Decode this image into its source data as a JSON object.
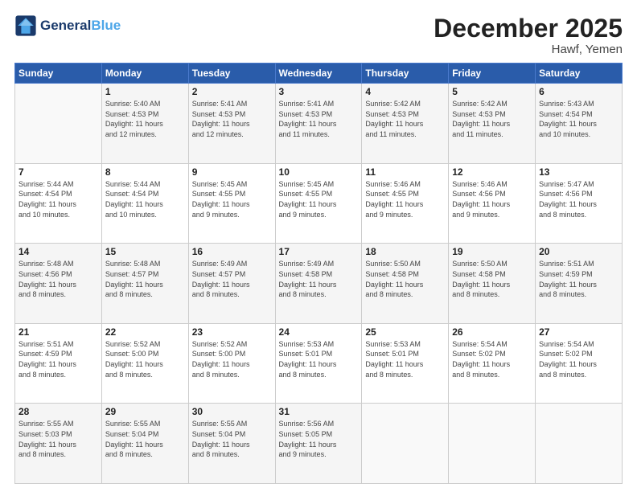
{
  "logo": {
    "line1": "General",
    "line2": "Blue"
  },
  "title": "December 2025",
  "subtitle": "Hawf, Yemen",
  "calendar": {
    "headers": [
      "Sunday",
      "Monday",
      "Tuesday",
      "Wednesday",
      "Thursday",
      "Friday",
      "Saturday"
    ],
    "weeks": [
      [
        {
          "day": "",
          "info": ""
        },
        {
          "day": "1",
          "info": "Sunrise: 5:40 AM\nSunset: 4:53 PM\nDaylight: 11 hours\nand 12 minutes."
        },
        {
          "day": "2",
          "info": "Sunrise: 5:41 AM\nSunset: 4:53 PM\nDaylight: 11 hours\nand 12 minutes."
        },
        {
          "day": "3",
          "info": "Sunrise: 5:41 AM\nSunset: 4:53 PM\nDaylight: 11 hours\nand 11 minutes."
        },
        {
          "day": "4",
          "info": "Sunrise: 5:42 AM\nSunset: 4:53 PM\nDaylight: 11 hours\nand 11 minutes."
        },
        {
          "day": "5",
          "info": "Sunrise: 5:42 AM\nSunset: 4:53 PM\nDaylight: 11 hours\nand 11 minutes."
        },
        {
          "day": "6",
          "info": "Sunrise: 5:43 AM\nSunset: 4:54 PM\nDaylight: 11 hours\nand 10 minutes."
        }
      ],
      [
        {
          "day": "7",
          "info": "Sunrise: 5:44 AM\nSunset: 4:54 PM\nDaylight: 11 hours\nand 10 minutes."
        },
        {
          "day": "8",
          "info": "Sunrise: 5:44 AM\nSunset: 4:54 PM\nDaylight: 11 hours\nand 10 minutes."
        },
        {
          "day": "9",
          "info": "Sunrise: 5:45 AM\nSunset: 4:55 PM\nDaylight: 11 hours\nand 9 minutes."
        },
        {
          "day": "10",
          "info": "Sunrise: 5:45 AM\nSunset: 4:55 PM\nDaylight: 11 hours\nand 9 minutes."
        },
        {
          "day": "11",
          "info": "Sunrise: 5:46 AM\nSunset: 4:55 PM\nDaylight: 11 hours\nand 9 minutes."
        },
        {
          "day": "12",
          "info": "Sunrise: 5:46 AM\nSunset: 4:56 PM\nDaylight: 11 hours\nand 9 minutes."
        },
        {
          "day": "13",
          "info": "Sunrise: 5:47 AM\nSunset: 4:56 PM\nDaylight: 11 hours\nand 8 minutes."
        }
      ],
      [
        {
          "day": "14",
          "info": "Sunrise: 5:48 AM\nSunset: 4:56 PM\nDaylight: 11 hours\nand 8 minutes."
        },
        {
          "day": "15",
          "info": "Sunrise: 5:48 AM\nSunset: 4:57 PM\nDaylight: 11 hours\nand 8 minutes."
        },
        {
          "day": "16",
          "info": "Sunrise: 5:49 AM\nSunset: 4:57 PM\nDaylight: 11 hours\nand 8 minutes."
        },
        {
          "day": "17",
          "info": "Sunrise: 5:49 AM\nSunset: 4:58 PM\nDaylight: 11 hours\nand 8 minutes."
        },
        {
          "day": "18",
          "info": "Sunrise: 5:50 AM\nSunset: 4:58 PM\nDaylight: 11 hours\nand 8 minutes."
        },
        {
          "day": "19",
          "info": "Sunrise: 5:50 AM\nSunset: 4:58 PM\nDaylight: 11 hours\nand 8 minutes."
        },
        {
          "day": "20",
          "info": "Sunrise: 5:51 AM\nSunset: 4:59 PM\nDaylight: 11 hours\nand 8 minutes."
        }
      ],
      [
        {
          "day": "21",
          "info": "Sunrise: 5:51 AM\nSunset: 4:59 PM\nDaylight: 11 hours\nand 8 minutes."
        },
        {
          "day": "22",
          "info": "Sunrise: 5:52 AM\nSunset: 5:00 PM\nDaylight: 11 hours\nand 8 minutes."
        },
        {
          "day": "23",
          "info": "Sunrise: 5:52 AM\nSunset: 5:00 PM\nDaylight: 11 hours\nand 8 minutes."
        },
        {
          "day": "24",
          "info": "Sunrise: 5:53 AM\nSunset: 5:01 PM\nDaylight: 11 hours\nand 8 minutes."
        },
        {
          "day": "25",
          "info": "Sunrise: 5:53 AM\nSunset: 5:01 PM\nDaylight: 11 hours\nand 8 minutes."
        },
        {
          "day": "26",
          "info": "Sunrise: 5:54 AM\nSunset: 5:02 PM\nDaylight: 11 hours\nand 8 minutes."
        },
        {
          "day": "27",
          "info": "Sunrise: 5:54 AM\nSunset: 5:02 PM\nDaylight: 11 hours\nand 8 minutes."
        }
      ],
      [
        {
          "day": "28",
          "info": "Sunrise: 5:55 AM\nSunset: 5:03 PM\nDaylight: 11 hours\nand 8 minutes."
        },
        {
          "day": "29",
          "info": "Sunrise: 5:55 AM\nSunset: 5:04 PM\nDaylight: 11 hours\nand 8 minutes."
        },
        {
          "day": "30",
          "info": "Sunrise: 5:55 AM\nSunset: 5:04 PM\nDaylight: 11 hours\nand 8 minutes."
        },
        {
          "day": "31",
          "info": "Sunrise: 5:56 AM\nSunset: 5:05 PM\nDaylight: 11 hours\nand 9 minutes."
        },
        {
          "day": "",
          "info": ""
        },
        {
          "day": "",
          "info": ""
        },
        {
          "day": "",
          "info": ""
        }
      ]
    ]
  }
}
